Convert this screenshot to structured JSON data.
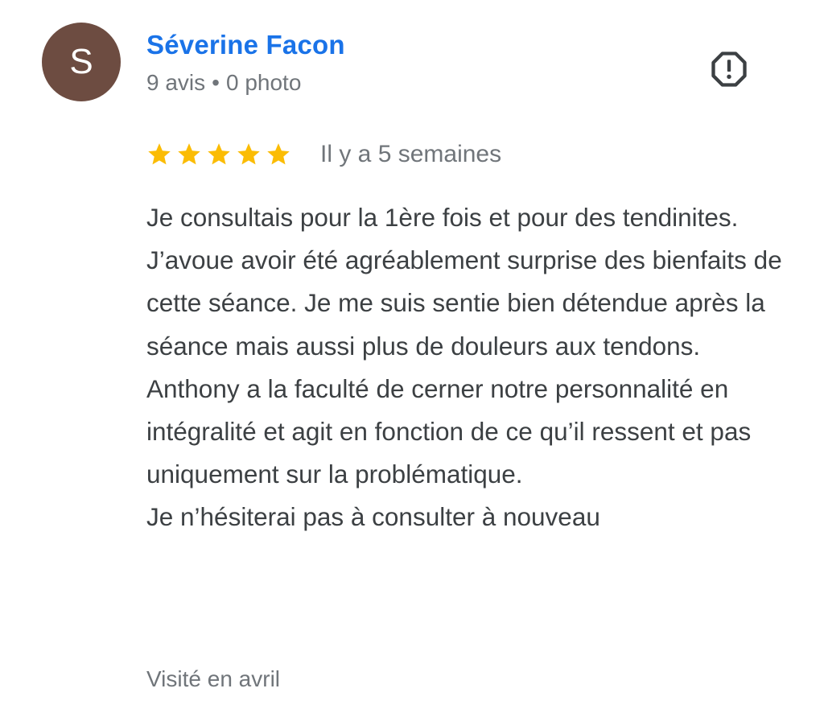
{
  "review": {
    "author": {
      "avatar_letter": "S",
      "avatar_color": "#6d4c41",
      "name": "Séverine Facon",
      "reviews_count": "9 avis",
      "separator": "•",
      "photos_count": "0 photo"
    },
    "report_icon": "report-flag-octagon-icon",
    "rating": {
      "stars": 5,
      "max_stars": 5,
      "star_color": "#fbbc04",
      "star_icon": "star-icon"
    },
    "date": "Il y a 5 semaines",
    "paragraphs": [
      "Je consultais pour la 1ère fois et pour des tendinites. J’avoue avoir été agréablement surprise des bienfaits de cette séance. Je me suis sentie bien détendue après la séance mais aussi plus de douleurs aux tendons. Anthony a la faculté de cerner notre personnalité en intégralité et agit en fonction de ce qu’il ressent et pas uniquement sur la problématique.",
      "Je n’hésiterai pas à consulter à nouveau"
    ],
    "visit": "Visité en avril"
  },
  "colors": {
    "name_link": "#1a73e8",
    "secondary_text": "#70757a",
    "body_text": "#3c4043"
  }
}
